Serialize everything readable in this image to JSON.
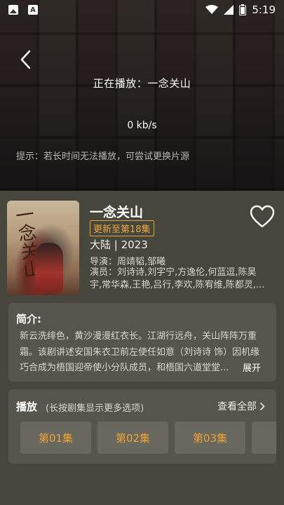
{
  "status_bar": {
    "time": "5:19",
    "left_icons": [
      "photo-icon",
      "a-icon"
    ],
    "right_icons": [
      "wifi-icon",
      "signal-icon",
      "battery-icon"
    ]
  },
  "player": {
    "now_playing": "正在播放：一念关山",
    "speed": "0 kb/s",
    "hint": "提示：若长时间无法播放，可尝试更换片源"
  },
  "show": {
    "title": "一念关山",
    "poster_title": "一念关山",
    "update_badge": "更新至第18集",
    "region_year": "大陆 | 2023",
    "director": "导演：周靖韬,邹曦",
    "actors": "演员：刘诗诗,刘宇宁,方逸伦,何蓝逗,陈昊宇,常华森,王艳,吕行,李欢,陈宥维,陈都灵,..."
  },
  "intro": {
    "title": "简介:",
    "text": "新云洗绯色，黄沙漫漫红衣长。江湖行远舟，关山阵阵万重霜。该剧讲述安国朱衣卫前左使任如意（刘诗诗 饰）因机缘巧合成为梧国迎帝使小分队成员，和梧国六道堂堂...",
    "expand_label": "展开"
  },
  "play": {
    "title": "播放",
    "subtitle": "(长按剧集显示更多选项)",
    "view_all": "查看全部",
    "episodes": [
      "第01集",
      "第02集",
      "第03集",
      ""
    ]
  },
  "colors": {
    "accent": "#f0a93e",
    "background": "#46463d",
    "card": "#55554b",
    "episode_button": "#68685e"
  }
}
